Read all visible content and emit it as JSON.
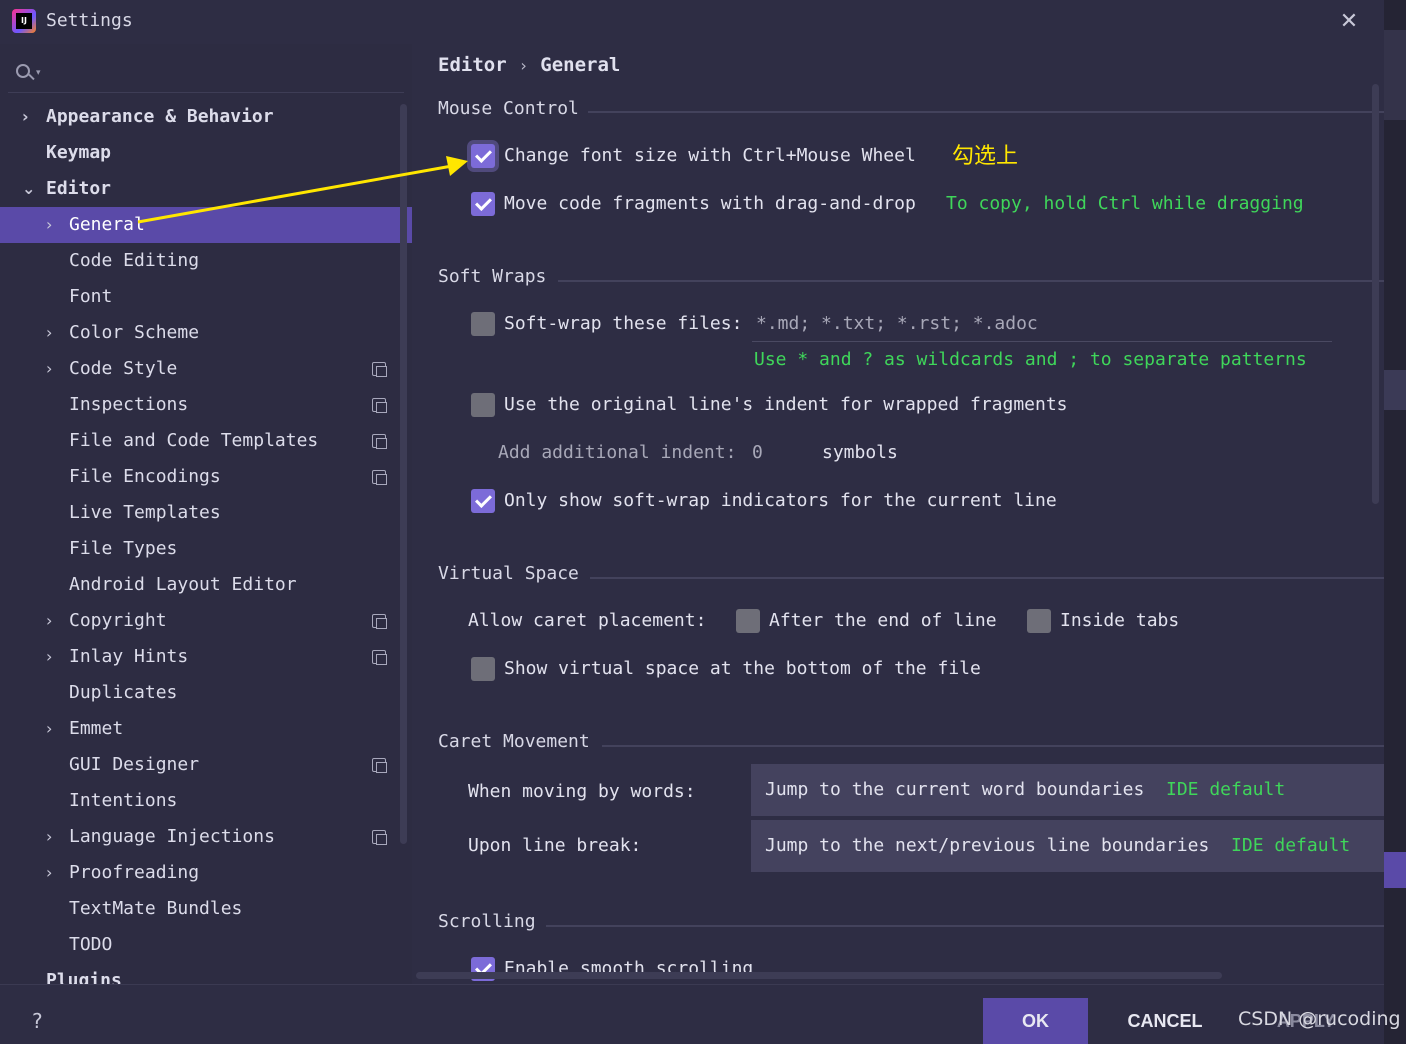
{
  "window": {
    "title": "Settings"
  },
  "sidebar": {
    "items": [
      {
        "label": "Appearance & Behavior",
        "level": 0,
        "chevron": "›",
        "project": false
      },
      {
        "label": "Keymap",
        "level": 0,
        "chevron": "",
        "project": false
      },
      {
        "label": "Editor",
        "level": 0,
        "chevron": "⌄",
        "project": false
      },
      {
        "label": "General",
        "level": 1,
        "chevron": "›",
        "project": false,
        "selected": true
      },
      {
        "label": "Code Editing",
        "level": 1,
        "chevron": "",
        "project": false
      },
      {
        "label": "Font",
        "level": 1,
        "chevron": "",
        "project": false
      },
      {
        "label": "Color Scheme",
        "level": 1,
        "chevron": "›",
        "project": false
      },
      {
        "label": "Code Style",
        "level": 1,
        "chevron": "›",
        "project": true
      },
      {
        "label": "Inspections",
        "level": 1,
        "chevron": "",
        "project": true
      },
      {
        "label": "File and Code Templates",
        "level": 1,
        "chevron": "",
        "project": true
      },
      {
        "label": "File Encodings",
        "level": 1,
        "chevron": "",
        "project": true
      },
      {
        "label": "Live Templates",
        "level": 1,
        "chevron": "",
        "project": false
      },
      {
        "label": "File Types",
        "level": 1,
        "chevron": "",
        "project": false
      },
      {
        "label": "Android Layout Editor",
        "level": 1,
        "chevron": "",
        "project": false
      },
      {
        "label": "Copyright",
        "level": 1,
        "chevron": "›",
        "project": true
      },
      {
        "label": "Inlay Hints",
        "level": 1,
        "chevron": "›",
        "project": true
      },
      {
        "label": "Duplicates",
        "level": 1,
        "chevron": "",
        "project": false
      },
      {
        "label": "Emmet",
        "level": 1,
        "chevron": "›",
        "project": false
      },
      {
        "label": "GUI Designer",
        "level": 1,
        "chevron": "",
        "project": true
      },
      {
        "label": "Intentions",
        "level": 1,
        "chevron": "",
        "project": false
      },
      {
        "label": "Language Injections",
        "level": 1,
        "chevron": "›",
        "project": true
      },
      {
        "label": "Proofreading",
        "level": 1,
        "chevron": "›",
        "project": false
      },
      {
        "label": "TextMate Bundles",
        "level": 1,
        "chevron": "",
        "project": false
      },
      {
        "label": "TODO",
        "level": 1,
        "chevron": "",
        "project": false
      },
      {
        "label": "Plugins",
        "level": 0,
        "chevron": "",
        "project": false
      }
    ]
  },
  "breadcrumb": {
    "parent": "Editor",
    "current": "General"
  },
  "mouse_control": {
    "title": "Mouse Control",
    "change_font": {
      "label": "Change font size with Ctrl+Mouse Wheel",
      "checked": true
    },
    "annotation": "勾选上",
    "move_code": {
      "label": "Move code fragments with drag-and-drop",
      "checked": true,
      "hint": "To copy, hold Ctrl while dragging"
    }
  },
  "soft_wraps": {
    "title": "Soft Wraps",
    "soft_wrap_files": {
      "label": "Soft-wrap these files:",
      "checked": false,
      "value": "*.md; *.txt; *.rst; *.adoc"
    },
    "patterns_hint": "Use * and ? as wildcards and ; to separate patterns",
    "original_indent": {
      "label": "Use the original line's indent for wrapped fragments",
      "checked": false
    },
    "additional_indent": {
      "label": "Add additional indent:",
      "value": "0",
      "unit": "symbols"
    },
    "indicators": {
      "label": "Only show soft-wrap indicators for the current line",
      "checked": true
    }
  },
  "virtual_space": {
    "title": "Virtual Space",
    "caret_label": "Allow caret placement:",
    "after_end": {
      "label": "After the end of line",
      "checked": false
    },
    "inside_tabs": {
      "label": "Inside tabs",
      "checked": false
    },
    "bottom": {
      "label": "Show virtual space at the bottom of the file",
      "checked": false
    }
  },
  "caret_movement": {
    "title": "Caret Movement",
    "words": {
      "label": "When moving by words:",
      "value": "Jump to the current word boundaries",
      "hint": "IDE default"
    },
    "line_break": {
      "label": "Upon line break:",
      "value": "Jump to the next/previous line boundaries",
      "hint": "IDE default"
    }
  },
  "scrolling": {
    "title": "Scrolling",
    "smooth": {
      "label": "Enable smooth scrolling",
      "checked": true
    }
  },
  "footer": {
    "help": "?",
    "ok": "OK",
    "cancel": "CANCEL",
    "apply": "APPLY"
  },
  "watermark": "CSDN @rucoding",
  "colors": {
    "accent": "#5a4aa8",
    "hint": "#3fd65a",
    "annotation": "#ffe600",
    "checkbox_on": "#7c6bd8"
  }
}
